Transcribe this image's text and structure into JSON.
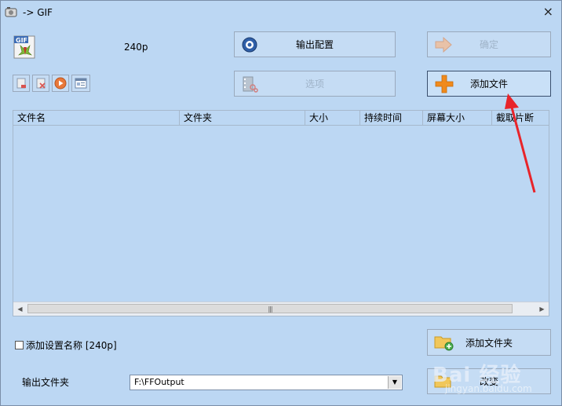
{
  "window": {
    "title": "-> GIF",
    "close_label": "×"
  },
  "preset": {
    "name": "240p"
  },
  "buttons": {
    "output_config": "输出配置",
    "confirm": "确定",
    "options": "选项",
    "add_file": "添加文件",
    "add_folder": "添加文件夹",
    "change": "改变"
  },
  "small_buttons": [
    "remove-icon",
    "clear-icon",
    "play-icon",
    "media-info-icon"
  ],
  "file_list": {
    "columns": [
      "文件名",
      "文件夹",
      "大小",
      "持续时间",
      "屏幕大小",
      "截取片断"
    ],
    "rows": []
  },
  "checkbox": {
    "label": "添加设置名称 [240p]",
    "checked": false
  },
  "output": {
    "label": "输出文件夹",
    "value": "F:\\FFOutput"
  },
  "watermark": {
    "brand": "Bai 经验",
    "sub": "jingyan.baidu.com"
  },
  "colors": {
    "background": "#bcd7f3",
    "arrow": "#e8242a"
  }
}
